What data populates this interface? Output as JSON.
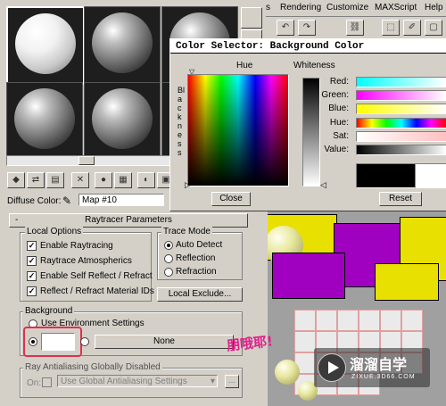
{
  "menubar": {
    "items": [
      "s",
      "Rendering",
      "Customize",
      "MAXScript",
      "Help"
    ]
  },
  "material_editor": {
    "diffuse_label": "Diffuse Color:",
    "map_name": "Map #10",
    "rollout_title": "Raytracer Parameters",
    "local_options": {
      "title": "Local Options",
      "items": [
        "Enable Raytracing",
        "Raytrace Atmospherics",
        "Enable Self Reflect / Refract",
        "Reflect / Refract Material IDs"
      ]
    },
    "trace_mode": {
      "title": "Trace Mode",
      "options": [
        "Auto Detect",
        "Reflection",
        "Refraction"
      ]
    },
    "local_exclude": "Local Exclude...",
    "background": {
      "title": "Background",
      "use_env": "Use Environment Settings",
      "none_button": "None"
    },
    "antialiasing": {
      "title": "Ray Antialiasing Globally Disabled",
      "on_label": "On:",
      "select_value": "Use Global Antialiasing Settings",
      "more_button": "..."
    }
  },
  "color_dialog": {
    "title": "Color Selector: Background Color",
    "hue_label": "Hue",
    "whiteness_label": "Whiteness",
    "blackness_label": "Blackness",
    "close": "Close",
    "reset": "Reset",
    "values": [
      "Red:",
      "Green:",
      "Blue:",
      "Hue:",
      "Sat:",
      "Value:"
    ]
  },
  "overlay": {
    "handwriting": "朋哦耶!",
    "watermark_brand": "溜溜自学",
    "watermark_url": "ZIXUE.3D66.COM"
  }
}
